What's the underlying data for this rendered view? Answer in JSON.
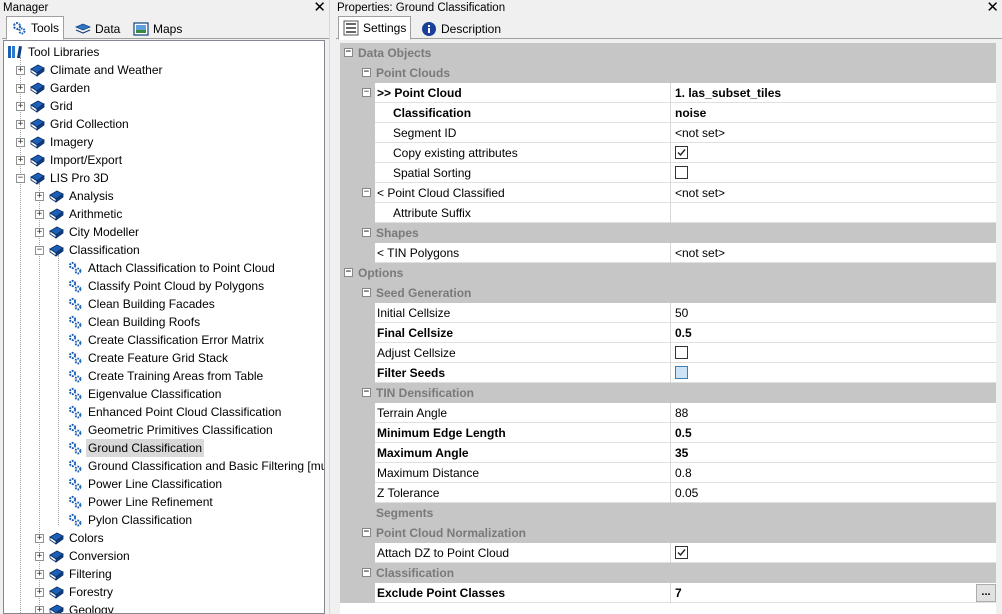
{
  "manager": {
    "title": "Manager",
    "tabs": [
      "Tools",
      "Data",
      "Maps"
    ],
    "tree": [
      {
        "label": "Tool Libraries",
        "level": 0,
        "expander": "",
        "icon": "library"
      },
      {
        "label": "Climate and Weather",
        "level": 1,
        "expander": "+",
        "icon": "book"
      },
      {
        "label": "Garden",
        "level": 1,
        "expander": "+",
        "icon": "book"
      },
      {
        "label": "Grid",
        "level": 1,
        "expander": "+",
        "icon": "book"
      },
      {
        "label": "Grid Collection",
        "level": 1,
        "expander": "+",
        "icon": "book"
      },
      {
        "label": "Imagery",
        "level": 1,
        "expander": "+",
        "icon": "book"
      },
      {
        "label": "Import/Export",
        "level": 1,
        "expander": "+",
        "icon": "book"
      },
      {
        "label": "LIS Pro 3D",
        "level": 1,
        "expander": "-",
        "icon": "book"
      },
      {
        "label": "Analysis",
        "level": 2,
        "expander": "+",
        "icon": "book"
      },
      {
        "label": "Arithmetic",
        "level": 2,
        "expander": "+",
        "icon": "book"
      },
      {
        "label": "City Modeller",
        "level": 2,
        "expander": "+",
        "icon": "book"
      },
      {
        "label": "Classification",
        "level": 2,
        "expander": "-",
        "icon": "book"
      },
      {
        "label": "Attach Classification to Point Cloud",
        "level": 3,
        "expander": "",
        "icon": "gear"
      },
      {
        "label": "Classify Point Cloud by Polygons",
        "level": 3,
        "expander": "",
        "icon": "gear"
      },
      {
        "label": "Clean Building Facades",
        "level": 3,
        "expander": "",
        "icon": "gear"
      },
      {
        "label": "Clean Building Roofs",
        "level": 3,
        "expander": "",
        "icon": "gear"
      },
      {
        "label": "Create Classification Error Matrix",
        "level": 3,
        "expander": "",
        "icon": "gear"
      },
      {
        "label": "Create Feature Grid Stack",
        "level": 3,
        "expander": "",
        "icon": "gear"
      },
      {
        "label": "Create Training Areas from Table",
        "level": 3,
        "expander": "",
        "icon": "gear"
      },
      {
        "label": "Eigenvalue Classification",
        "level": 3,
        "expander": "",
        "icon": "gear"
      },
      {
        "label": "Enhanced Point Cloud Classification",
        "level": 3,
        "expander": "",
        "icon": "gear"
      },
      {
        "label": "Geometric Primitives Classification",
        "level": 3,
        "expander": "",
        "icon": "gear"
      },
      {
        "label": "Ground Classification",
        "level": 3,
        "expander": "",
        "icon": "gear",
        "selected": true
      },
      {
        "label": "Ground Classification and Basic Filtering [mu",
        "level": 3,
        "expander": "",
        "icon": "gear"
      },
      {
        "label": "Power Line Classification",
        "level": 3,
        "expander": "",
        "icon": "gear"
      },
      {
        "label": "Power Line Refinement",
        "level": 3,
        "expander": "",
        "icon": "gear"
      },
      {
        "label": "Pylon Classification",
        "level": 3,
        "expander": "",
        "icon": "gear"
      },
      {
        "label": "Colors",
        "level": 2,
        "expander": "+",
        "icon": "book"
      },
      {
        "label": "Conversion",
        "level": 2,
        "expander": "+",
        "icon": "book"
      },
      {
        "label": "Filtering",
        "level": 2,
        "expander": "+",
        "icon": "book"
      },
      {
        "label": "Forestry",
        "level": 2,
        "expander": "+",
        "icon": "book"
      },
      {
        "label": "Geology",
        "level": 2,
        "expander": "+",
        "icon": "book"
      }
    ]
  },
  "properties": {
    "title": "Properties: Ground Classification",
    "tabs": [
      "Settings",
      "Description"
    ],
    "rows": [
      {
        "type": "cat",
        "depth": 0,
        "name": "Data Objects",
        "toggle": "-"
      },
      {
        "type": "cat",
        "depth": 1,
        "name": "Point Clouds",
        "toggle": "-"
      },
      {
        "type": "prop",
        "depth": 1,
        "name": ">> Point Cloud",
        "bold": true,
        "value": "1. las_subset_tiles",
        "valbold": true,
        "toggle": "-"
      },
      {
        "type": "prop",
        "depth": 2,
        "name": "Classification",
        "bold": true,
        "value": "noise",
        "valbold": true
      },
      {
        "type": "prop",
        "depth": 2,
        "name": "Segment ID",
        "value": "<not set>"
      },
      {
        "type": "prop",
        "depth": 2,
        "name": "Copy existing attributes",
        "check": true
      },
      {
        "type": "prop",
        "depth": 2,
        "name": "Spatial Sorting",
        "check": false
      },
      {
        "type": "prop",
        "depth": 1,
        "name": "< Point Cloud Classified",
        "value": "<not set>",
        "toggle": "-"
      },
      {
        "type": "prop",
        "depth": 2,
        "name": "Attribute Suffix",
        "value": ""
      },
      {
        "type": "cat",
        "depth": 1,
        "name": "Shapes",
        "toggle": "-"
      },
      {
        "type": "prop",
        "depth": 1,
        "name": "< TIN Polygons",
        "value": "<not set>"
      },
      {
        "type": "cat",
        "depth": 0,
        "name": "Options",
        "toggle": "-"
      },
      {
        "type": "cat",
        "depth": 1,
        "name": "Seed Generation",
        "toggle": "-"
      },
      {
        "type": "prop",
        "depth": 1,
        "name": "Initial Cellsize",
        "value": "50"
      },
      {
        "type": "prop",
        "depth": 1,
        "name": "Final Cellsize",
        "bold": true,
        "value": "0.5",
        "valbold": true
      },
      {
        "type": "prop",
        "depth": 1,
        "name": "Adjust Cellsize",
        "check": false
      },
      {
        "type": "prop",
        "depth": 1,
        "name": "Filter Seeds",
        "bold": true,
        "check": false,
        "checkstyle": "blue"
      },
      {
        "type": "cat",
        "depth": 1,
        "name": "TIN Densification",
        "toggle": "-"
      },
      {
        "type": "prop",
        "depth": 1,
        "name": "Terrain Angle",
        "value": "88"
      },
      {
        "type": "prop",
        "depth": 1,
        "name": "Minimum Edge Length",
        "bold": true,
        "value": "0.5",
        "valbold": true
      },
      {
        "type": "prop",
        "depth": 1,
        "name": "Maximum Angle",
        "bold": true,
        "value": "35",
        "valbold": true
      },
      {
        "type": "prop",
        "depth": 1,
        "name": "Maximum Distance",
        "value": "0.8"
      },
      {
        "type": "prop",
        "depth": 1,
        "name": "Z Tolerance",
        "value": "0.05"
      },
      {
        "type": "cat",
        "depth": 1,
        "name": "Segments",
        "toggle": ""
      },
      {
        "type": "cat",
        "depth": 1,
        "name": "Point Cloud Normalization",
        "toggle": "-"
      },
      {
        "type": "prop",
        "depth": 1,
        "name": "Attach DZ to Point Cloud",
        "check": true
      },
      {
        "type": "cat",
        "depth": 1,
        "name": "Classification",
        "toggle": "-"
      },
      {
        "type": "prop",
        "depth": 1,
        "name": "Exclude Point Classes",
        "bold": true,
        "value": "7",
        "valbold": true,
        "ellipsis": "..."
      }
    ]
  },
  "colors": {
    "category_bg": "#c6c6c6",
    "icon_blue": "#1c5fb5",
    "selected_bg": "#d9d9d9"
  }
}
